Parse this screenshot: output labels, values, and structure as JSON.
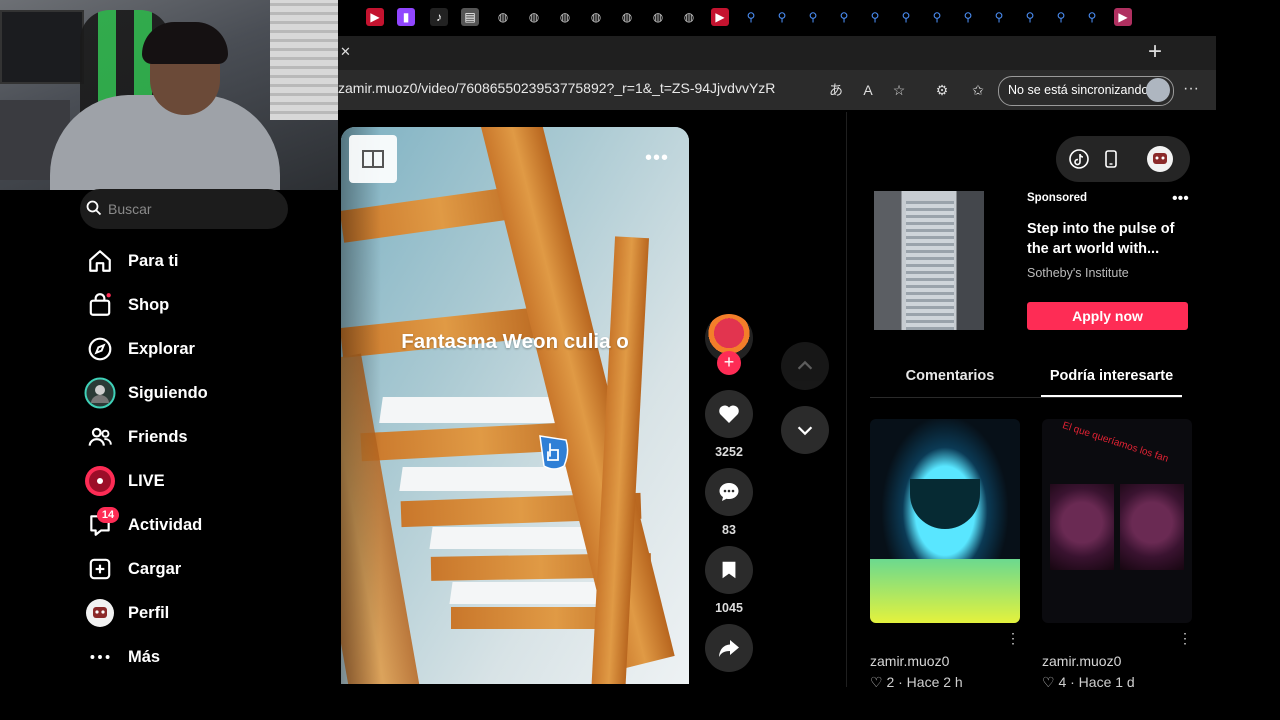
{
  "browser": {
    "url": "zamir.muoz0/video/7608655023953775892?_r=1&_t=ZS-94JjvdvvYzR",
    "sync_label": "No se está sincronizando",
    "close_tab_glyph": "✕",
    "new_tab_glyph": "+",
    "more_glyph": "···"
  },
  "sidebar": {
    "search_placeholder": "Buscar",
    "items": [
      {
        "label": "Para ti",
        "icon": "home-icon"
      },
      {
        "label": "Shop",
        "icon": "shop-icon"
      },
      {
        "label": "Explorar",
        "icon": "compass-icon"
      },
      {
        "label": "Siguiendo",
        "icon": "following-avatar-icon"
      },
      {
        "label": "Friends",
        "icon": "friends-icon"
      },
      {
        "label": "LIVE",
        "icon": "live-icon"
      },
      {
        "label": "Actividad",
        "icon": "activity-icon",
        "badge": "14"
      },
      {
        "label": "Cargar",
        "icon": "upload-icon"
      },
      {
        "label": "Perfil",
        "icon": "profile-avatar-icon"
      },
      {
        "label": "Más",
        "icon": "more-icon"
      }
    ]
  },
  "video": {
    "caption": "Fantasma Weon culia o",
    "more_glyph": "•••"
  },
  "actions": {
    "follow_glyph": "+",
    "likes": "3252",
    "comments": "83",
    "saves": "1045"
  },
  "ad": {
    "sponsored": "Sponsored",
    "title": "Step into the pulse of the art world with...",
    "brand": "Sotheby's Institute",
    "cta": "Apply now",
    "more_glyph": "•••"
  },
  "tabs": {
    "comments": "Comentarios",
    "interest": "Podría interesarte"
  },
  "cards": [
    {
      "user": "zamir.muoz0",
      "meta": "♡ 2 · Hace 2 h"
    },
    {
      "user": "zamir.muoz0",
      "meta": "♡ 4 · Hace 1 d",
      "overlay_text": "El que queríamos los fan"
    }
  ],
  "colors": {
    "accent": "#fe2c55",
    "background": "#000000"
  }
}
